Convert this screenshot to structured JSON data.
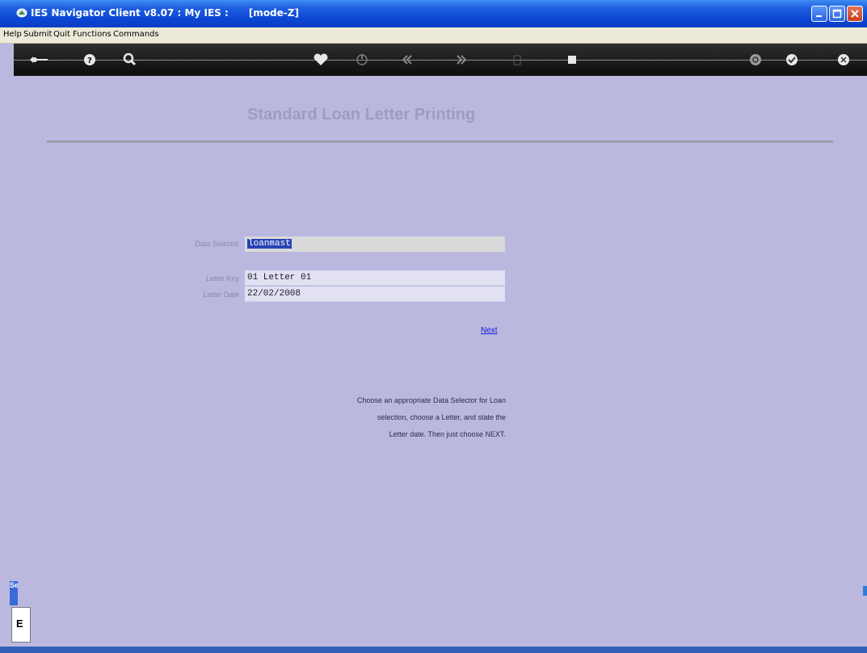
{
  "window": {
    "title": "IES Navigator Client v8.07 : My IES :      [mode-Z]"
  },
  "menu": {
    "items": [
      "Help",
      "Submit",
      "Quit",
      "Functions",
      "Commands"
    ]
  },
  "toolbar": {
    "icons": [
      "back-arrow-icon",
      "help-icon",
      "search-icon",
      "heart-icon",
      "power-icon",
      "rewind-icon",
      "fast-forward-icon",
      "document-icon",
      "stop-icon",
      "refresh-icon",
      "ok-icon",
      "close-icon"
    ]
  },
  "page": {
    "title": "Standard Loan Letter Printing"
  },
  "form": {
    "data_selector_label": "Data Selector",
    "data_selector_value": "loanmast",
    "letter_key_label": "Letter Key",
    "letter_key_value": "01 Letter 01",
    "letter_date_label": "Letter Date",
    "letter_date_value": "22/02/2008",
    "next_label": "Next"
  },
  "help": {
    "lines": [
      "Choose an appropriate Data Selector for Loan",
      "selection, choose a Letter, and state the",
      "Letter date. Then just choose NEXT."
    ]
  },
  "side": {
    "tab_label": "Se",
    "panel_text": "E"
  }
}
